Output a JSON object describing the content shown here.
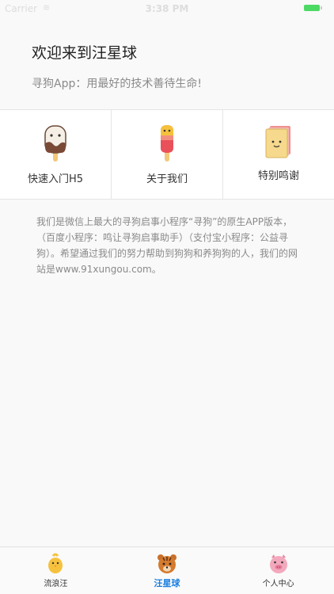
{
  "status_bar": {
    "carrier": "Carrier",
    "wifi": "≋",
    "time": "3:38 PM"
  },
  "header": {
    "title": "欢迎来到汪星球",
    "subtitle": "寻狗App：用最好的技术善待生命!"
  },
  "grid": [
    {
      "label": "快速入门H5",
      "icon": "popsicle-icon"
    },
    {
      "label": "关于我们",
      "icon": "ice-pop-icon"
    },
    {
      "label": "特别鸣谢",
      "icon": "notepad-icon"
    }
  ],
  "description": "我们是微信上最大的寻狗启事小程序“寻狗”的原生APP版本，（百度小程序：鸣让寻狗启事助手）（支付宝小程序：公益寻狗）。希望通过我们的努力帮助到狗狗和养狗狗的人，我们的网站是www.91xungou.com。",
  "tabbar": {
    "items": [
      {
        "label": "流浪汪",
        "icon": "chick-icon",
        "active": false
      },
      {
        "label": "汪星球",
        "icon": "tiger-icon",
        "active": true
      },
      {
        "label": "个人中心",
        "icon": "pig-icon",
        "active": false
      }
    ],
    "active_color": "#1a7ee0"
  }
}
